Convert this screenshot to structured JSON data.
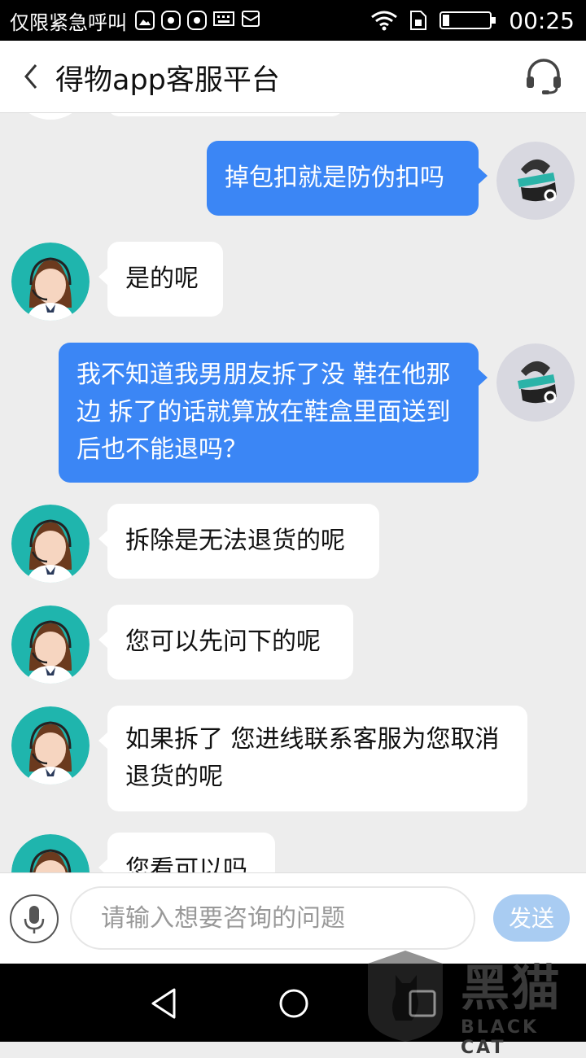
{
  "status_bar": {
    "app_name": "仅限紧急呼叫",
    "time": "00:25",
    "icons": [
      "gallery-icon",
      "huawei-icon",
      "huawei-icon",
      "keyboard-icon",
      "mail-icon",
      "wifi-icon",
      "sim-icon",
      "battery-icon"
    ]
  },
  "header": {
    "title": "得物app客服平台",
    "back_icon": "chevron-left-icon",
    "service_icon": "headset-icon"
  },
  "messages": [
    {
      "side": "out",
      "text": "掉包扣就是防伪扣吗"
    },
    {
      "side": "in",
      "text": "是的呢"
    },
    {
      "side": "out",
      "text": "我不知道我男朋友拆了没 鞋在他那边 拆了的话就算放在鞋盒里面送到后也不能退吗？"
    },
    {
      "side": "in",
      "text": "拆除是无法退货的呢"
    },
    {
      "side": "in",
      "text": "您可以先问下的呢"
    },
    {
      "side": "in",
      "text": "如果拆了 您进线联系客服为您取消退货的呢"
    },
    {
      "side": "in",
      "text": "您看可以吗"
    }
  ],
  "input_bar": {
    "placeholder": "请输入想要咨询的问题",
    "send_label": "发送",
    "mic_icon": "microphone-icon"
  },
  "nav_bar": {
    "icons": [
      "nav-back-icon",
      "nav-home-icon",
      "nav-recent-icon"
    ]
  },
  "watermark": {
    "text": "黑猫",
    "sub": "BLACK CAT"
  },
  "colors": {
    "outgoing_bubble": "#3b86f5",
    "incoming_bubble": "#ffffff",
    "chat_background": "#ededed",
    "send_button": "#a9ccf2",
    "agent_avatar_bg": "#1fb5ad"
  }
}
